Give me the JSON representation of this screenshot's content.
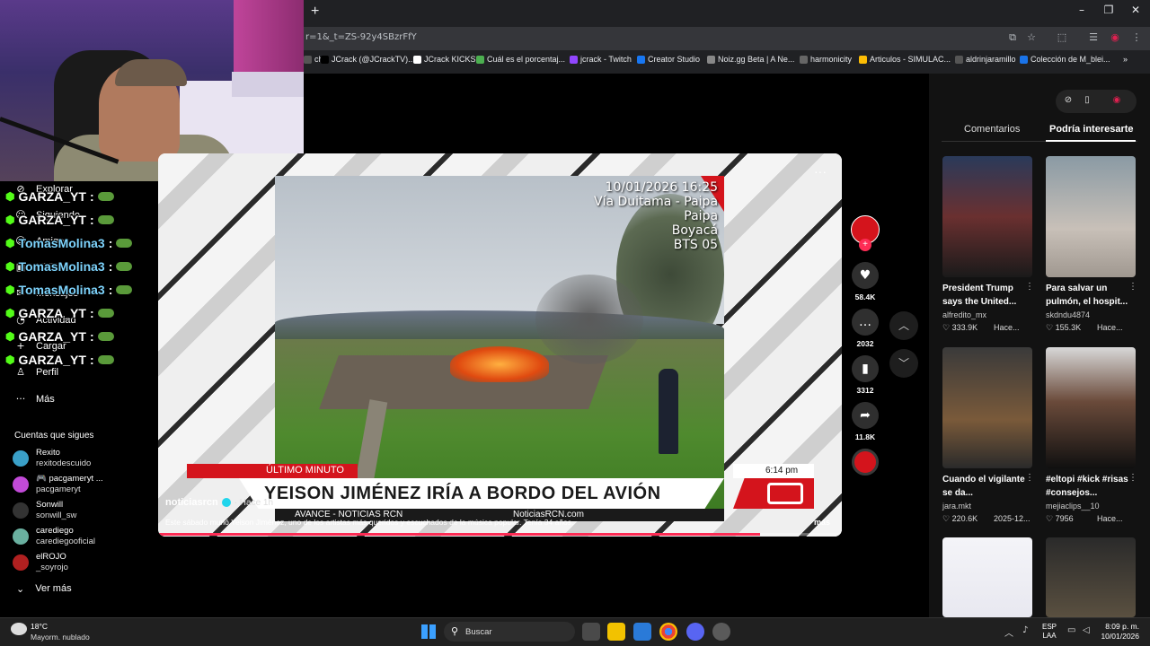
{
  "browser": {
    "url": "r=1&_t=ZS-92y4SBzrFfY",
    "new_tab": "+",
    "minimize": "–",
    "restore": "❐",
    "close": "✕",
    "bookmarks": [
      {
        "label": "ch",
        "color": "#555"
      },
      {
        "label": "JCrack (@JCrackTV)...",
        "color": "#000"
      },
      {
        "label": "JCrack KICKS",
        "color": "#fff"
      },
      {
        "label": "Cuál es el porcentaj...",
        "color": "#4caf50"
      },
      {
        "label": "jcrack - Twitch",
        "color": "#9146ff"
      },
      {
        "label": "Creator Studio",
        "color": "#1877f2"
      },
      {
        "label": "Noiz.gg Beta | A Ne...",
        "color": "#888"
      },
      {
        "label": "harmonicity",
        "color": "#666"
      },
      {
        "label": "Articulos - SIMULAC...",
        "color": "#fbbc04"
      },
      {
        "label": "aldrinjaramillo",
        "color": "#555"
      },
      {
        "label": "Colección de M_blei...",
        "color": "#1a73e8"
      }
    ],
    "bookmarks_more": "»"
  },
  "sidebar": {
    "nav": [
      {
        "icon": "compass-icon",
        "glyph": "⊘",
        "label": "Explorar"
      },
      {
        "icon": "following-icon",
        "glyph": "☺",
        "label": "Siguiendo"
      },
      {
        "icon": "friends-icon",
        "glyph": "☺",
        "label": "Amigos"
      },
      {
        "icon": "live-icon",
        "glyph": "▣",
        "label": "LIVE"
      },
      {
        "icon": "messages-icon",
        "glyph": "✉",
        "label": "Mensajes"
      },
      {
        "icon": "activity-icon",
        "glyph": "◔",
        "label": "Actividad"
      },
      {
        "icon": "upload-icon",
        "glyph": "+",
        "label": "Cargar"
      },
      {
        "icon": "profile-icon",
        "glyph": "♙",
        "label": "Perfil"
      },
      {
        "icon": "more-icon",
        "glyph": "···",
        "label": "Más"
      }
    ],
    "chat": [
      {
        "user": "GARZA_YT",
        "color": "#fff"
      },
      {
        "user": "GARZA_YT",
        "color": "#fff"
      },
      {
        "user": "TomasMolina3",
        "color": "#7dd3fc"
      },
      {
        "user": "TomasMolina3",
        "color": "#7dd3fc"
      },
      {
        "user": "TomasMolina3",
        "color": "#7dd3fc"
      },
      {
        "user": "GARZA_YT",
        "color": "#fff"
      },
      {
        "user": "GARZA_YT",
        "color": "#fff"
      },
      {
        "user": "GARZA_YT",
        "color": "#fff"
      }
    ],
    "chat_separator": ":",
    "following_title": "Cuentas que sigues",
    "accounts": [
      {
        "name": "Rexito",
        "handle": "rexitodescuido",
        "color": "#3aa0c8"
      },
      {
        "name": "🎮 pacgameryt ...",
        "handle": "pacgameryt",
        "color": "#c24ad8"
      },
      {
        "name": "Sonwill",
        "handle": "sonwill_sw",
        "color": "#333"
      },
      {
        "name": "carediego",
        "handle": "carediegooficial",
        "color": "#6ab0a0"
      },
      {
        "name": "elROJO",
        "handle": "_soyrojo",
        "color": "#b02020"
      }
    ],
    "see_more": "Ver más"
  },
  "video": {
    "overlay_date": "10/01/2026 16:25",
    "overlay_location": [
      "Vía Duitama - Paipa",
      "Paipa",
      "Boyacá",
      "BTS 05"
    ],
    "breaking_label": "ÚLTIMO MINUTO",
    "headline": "YEISON JIMÉNEZ IRÍA A BORDO DEL AVIÓN",
    "time": "6:14 pm",
    "avance": "AVANCE - NOTICIAS RCN",
    "watermark": "NoticiasRCN.com",
    "channel": "noticiasrcn",
    "posted": "· Hace 1h",
    "caption": "Este sábado murió Yeison Jiménez, uno de los artistas más queridos y escuchados de la música popular. Tenía 34 años.",
    "more": "más",
    "more_dots": "···",
    "progress": 0.88
  },
  "actions": {
    "likes": "58.4K",
    "comments": "2032",
    "saves": "3312",
    "shares": "11.8K",
    "like_glyph": "♥",
    "comment_glyph": "…",
    "save_glyph": "▮",
    "share_glyph": "➦",
    "up_glyph": "︿",
    "down_glyph": "﹀",
    "plus": "+"
  },
  "right_panel": {
    "tab_comments": "Comentarios",
    "tab_interesting": "Podría interesarte",
    "cards": [
      {
        "title": "President Trump says the United...",
        "user": "alfredito_mx",
        "views": "♡ 333.9K",
        "date": "Hace...",
        "bg": "linear-gradient(180deg,#2a3a5a,#6a3030 50%,#1a1a1a)"
      },
      {
        "title": "Para salvar un pulmón, el hospit...",
        "user": "skdndu4874",
        "views": "♡ 155.3K",
        "date": "Hace...",
        "bg": "linear-gradient(180deg,#8a9aa4,#c8c0b8 60%,#a09890)"
      },
      {
        "title": "Cuando el vigilante se da...",
        "user": "jara.mkt",
        "views": "♡ 220.6K",
        "date": "2025-12...",
        "bg": "linear-gradient(180deg,#3a3a3a,#7a5a3a 60%,#2a2a2a)"
      },
      {
        "title": "#eltopi #kick #risas #consejos...",
        "user": "mejiaclips__10",
        "views": "♡ 7956",
        "date": "Hace...",
        "bg": "linear-gradient(180deg,#d8d8d8,#6a4a3a 45%,#101010)"
      },
      {
        "title": "",
        "user": "",
        "views": "",
        "date": "",
        "bg": "linear-gradient(180deg,#f4f4f8,#e8e8f0)"
      },
      {
        "title": "",
        "user": "",
        "views": "",
        "date": "",
        "bg": "linear-gradient(180deg,#2a2a2a,#5a5040)"
      }
    ],
    "card_menu": "⋮"
  },
  "taskbar": {
    "temp": "18°C",
    "weather": "Mayorm. nublado",
    "search": "Buscar",
    "lang": [
      "ESP",
      "LAA"
    ],
    "time": "8:09 p. m.",
    "date": "10/01/2026"
  },
  "colors": {
    "accent": "#fe2c55",
    "rcn_red": "#d4141c",
    "kick_green": "#53fc18"
  }
}
